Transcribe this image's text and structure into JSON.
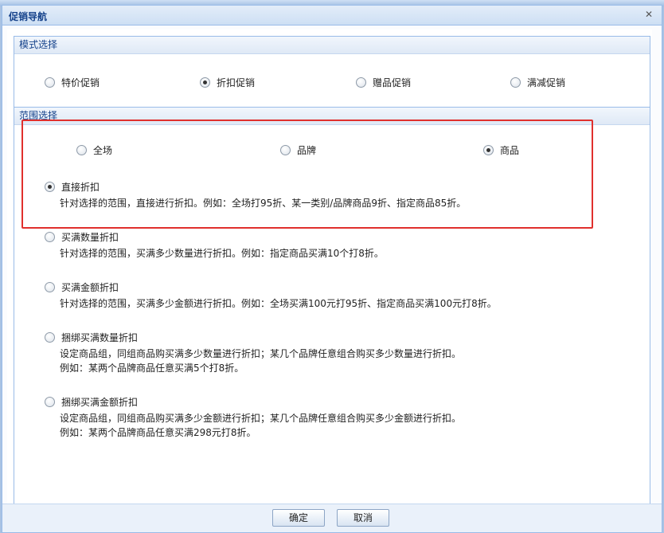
{
  "dialog": {
    "title": "促销导航",
    "close_glyph": "✕"
  },
  "mode_section": {
    "legend": "模式选择",
    "options": [
      {
        "label": "特价促销",
        "checked": false
      },
      {
        "label": "折扣促销",
        "checked": true
      },
      {
        "label": "赠品促销",
        "checked": false
      },
      {
        "label": "满减促销",
        "checked": false
      }
    ]
  },
  "scope_section": {
    "legend": "范围选择",
    "scope_options": [
      {
        "label": "全场",
        "checked": false
      },
      {
        "label": "品牌",
        "checked": false
      },
      {
        "label": "商品",
        "checked": true
      }
    ],
    "discount_types": [
      {
        "label": "直接折扣",
        "checked": true,
        "desc": [
          "针对选择的范围，直接进行折扣。例如：全场打95折、某一类别/品牌商品9折、指定商品85折。"
        ]
      },
      {
        "label": "买满数量折扣",
        "checked": false,
        "desc": [
          "针对选择的范围，买满多少数量进行折扣。例如：指定商品买满10个打8折。"
        ]
      },
      {
        "label": "买满金额折扣",
        "checked": false,
        "desc": [
          "针对选择的范围，买满多少金额进行折扣。例如：全场买满100元打95折、指定商品买满100元打8折。"
        ]
      },
      {
        "label": "捆绑买满数量折扣",
        "checked": false,
        "desc": [
          "设定商品组，同组商品购买满多少数量进行折扣；某几个品牌任意组合购买多少数量进行折扣。",
          "例如：某两个品牌商品任意买满5个打8折。"
        ]
      },
      {
        "label": "捆绑买满金额折扣",
        "checked": false,
        "desc": [
          "设定商品组，同组商品购买满多少金额进行折扣；某几个品牌任意组合购买多少金额进行折扣。",
          "例如：某两个品牌商品任意买满298元打8折。"
        ]
      }
    ]
  },
  "footer": {
    "ok_label": "确定",
    "cancel_label": "取消"
  },
  "colors": {
    "accent": "#15428b",
    "border": "#99bbe8",
    "highlight": "#e0302d"
  }
}
